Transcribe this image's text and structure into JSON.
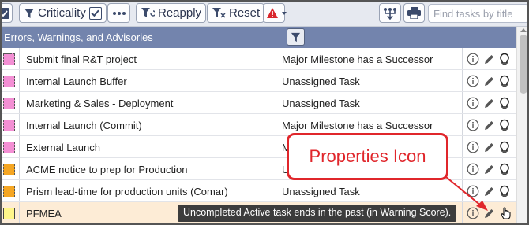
{
  "toolbar": {
    "criticality_label": "Criticality",
    "reapply_label": "Reapply",
    "reset_label": "Reset",
    "search_placeholder": "Find tasks by title"
  },
  "group": {
    "title": "Errors, Warnings, and Advisories"
  },
  "rows": [
    {
      "name": "Submit final R&T project",
      "advisory": "Major Milestone has a Successor",
      "chip_color": "#f38fd4",
      "chip_style": "dashed"
    },
    {
      "name": "Internal Launch Buffer",
      "advisory": "Unassigned Task",
      "chip_color": "#f38fd4",
      "chip_style": "dashed"
    },
    {
      "name": "Marketing & Sales - Deployment",
      "advisory": "Unassigned Task",
      "chip_color": "#f38fd4",
      "chip_style": "dashed"
    },
    {
      "name": "Internal Launch (Commit)",
      "advisory": "Major Milestone has a Successor",
      "chip_color": "#f38fd4",
      "chip_style": "dashed"
    },
    {
      "name": "External Launch",
      "advisory": "M",
      "chip_color": "#f38fd4",
      "chip_style": "dashed"
    },
    {
      "name": "ACME notice to prep for Production",
      "advisory": "U",
      "chip_color": "#f5a623",
      "chip_style": "dashed"
    },
    {
      "name": "Prism lead-time for production units (Comar)",
      "advisory": "Unassigned Task",
      "chip_color": "#f5a623",
      "chip_style": "dashed"
    },
    {
      "name": "PFMEA",
      "advisory": "",
      "chip_color": "#fff68a",
      "chip_style": "solid"
    }
  ],
  "tooltip": "Uncompleted Active task ends in the past (in Warning Score).",
  "callout": "Properties Icon",
  "colors": {
    "header": "#7384ad",
    "highlight_row": "#fdecd6",
    "callout": "#e0262b",
    "warning": "#d9262c"
  }
}
